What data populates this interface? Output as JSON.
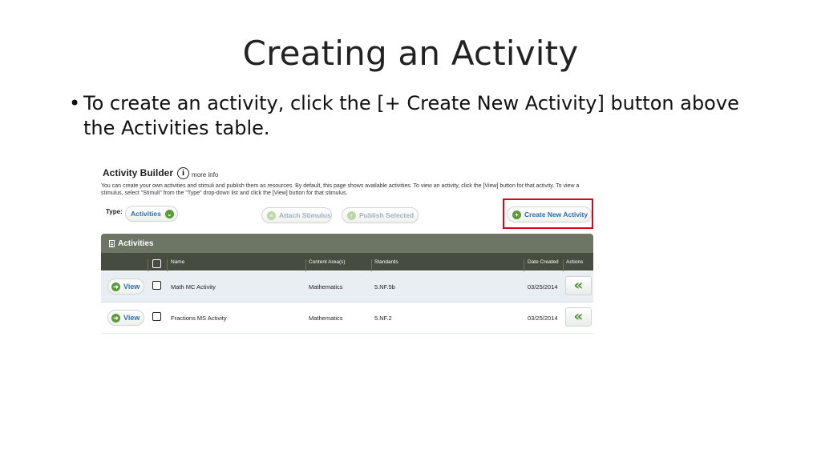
{
  "slide": {
    "title": "Creating an Activity",
    "bullet": "To create an activity, click the [+ Create New Activity] button above the Activities table."
  },
  "activity_builder": {
    "title": "Activity Builder",
    "more_info": "more info",
    "description": "You can create your own activities and stimuli and publish them as resources. By default, this page shows available activities. To view an activity, click the [View] button for that activity. To view a stimulus, select \"Stimuli\" from the \"Type\" drop-down list and click the [View] button for that stimulus.",
    "type_label": "Type:",
    "type_value": "Activities",
    "attach_stimulus": "Attach Stimulus",
    "publish_selected": "Publish Selected",
    "create_new_activity": "Create New Activity"
  },
  "table": {
    "title": "Activities",
    "columns": [
      "Name",
      "Content Area(s)",
      "Standards",
      "Date Created",
      "Actions"
    ],
    "view_label": "View",
    "rows": [
      {
        "name": "Math MC Activity",
        "content_area": "Mathematics",
        "standards": "5.NF.5b",
        "date_created": "03/25/2014"
      },
      {
        "name": "Fractions MS Activity",
        "content_area": "Mathematics",
        "standards": "5.NF.2",
        "date_created": "03/25/2014"
      }
    ]
  },
  "colors": {
    "highlight": "#e0001b",
    "header": "#6d7565",
    "accent": "#2d6fb3",
    "green": "#5a9a3a"
  }
}
